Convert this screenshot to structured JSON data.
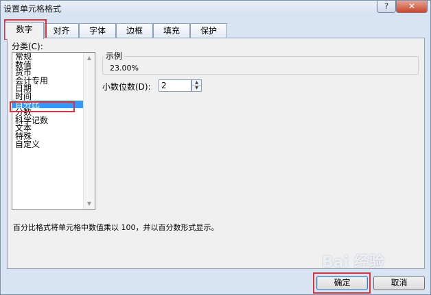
{
  "window": {
    "title": "设置单元格格式",
    "help_label": "?",
    "close_label": "✕"
  },
  "tabs": [
    {
      "label": "数字",
      "active": true
    },
    {
      "label": "对齐",
      "active": false
    },
    {
      "label": "字体",
      "active": false
    },
    {
      "label": "边框",
      "active": false
    },
    {
      "label": "填充",
      "active": false
    },
    {
      "label": "保护",
      "active": false
    }
  ],
  "category": {
    "label": "分类(C):",
    "items": [
      "常规",
      "数值",
      "货币",
      "会计专用",
      "日期",
      "时间",
      "百分比",
      "分数",
      "科学记数",
      "文本",
      "特殊",
      "自定义"
    ],
    "selected": "百分比"
  },
  "sample": {
    "label": "示例",
    "value": "23.00%"
  },
  "decimal_places": {
    "label": "小数位数(D):",
    "value": "2"
  },
  "description": "百分比格式将单元格中数值乘以 100，并以百分数形式显示。",
  "buttons": {
    "ok": "确定",
    "cancel": "取消"
  },
  "watermark": "Bai 经验",
  "colors": {
    "selection": "#3399ff",
    "highlight": "#e0303a"
  }
}
